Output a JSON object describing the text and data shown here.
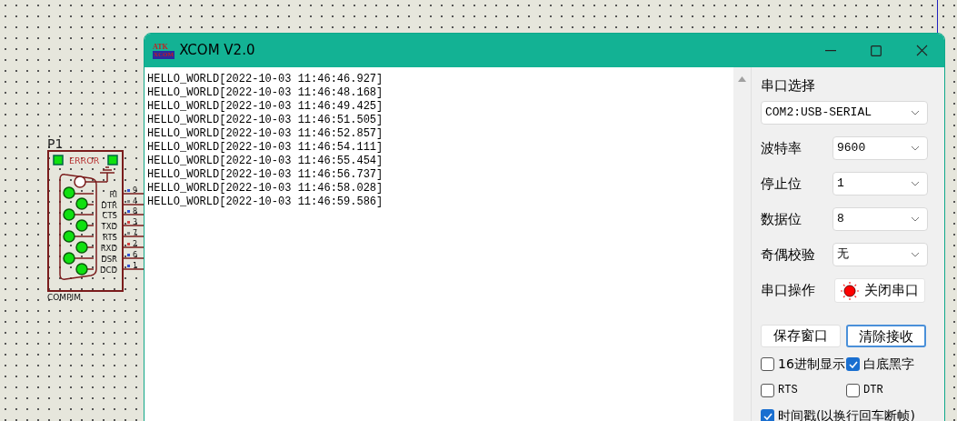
{
  "schematic": {
    "ref": "P1",
    "type": "COMPIM",
    "error_label": "ERROR",
    "pins": [
      {
        "name": "RI",
        "number": "9",
        "color": "#3050d0"
      },
      {
        "name": "DTR",
        "number": "4",
        "color": "#808080"
      },
      {
        "name": "CTS",
        "number": "8",
        "color": "#3050d0"
      },
      {
        "name": "TXD",
        "number": "3",
        "color": "#d04040"
      },
      {
        "name": "RTS",
        "number": "7",
        "color": "#808080"
      },
      {
        "name": "RXD",
        "number": "2",
        "color": "#d04040"
      },
      {
        "name": "DSR",
        "number": "6",
        "color": "#3050d0"
      },
      {
        "name": "DCD",
        "number": "1",
        "color": "#3050d0"
      }
    ]
  },
  "window": {
    "title": "XCOM V2.0",
    "logo_top": "ATK",
    "logo_bottom": "XCOM",
    "receive_lines": [
      "HELLO_WORLD[2022-10-03 11:46:46.927]",
      "HELLO_WORLD[2022-10-03 11:46:48.168]",
      "HELLO_WORLD[2022-10-03 11:46:49.425]",
      "HELLO_WORLD[2022-10-03 11:46:51.505]",
      "HELLO_WORLD[2022-10-03 11:46:52.857]",
      "HELLO_WORLD[2022-10-03 11:46:54.111]",
      "HELLO_WORLD[2022-10-03 11:46:55.454]",
      "HELLO_WORLD[2022-10-03 11:46:56.737]",
      "HELLO_WORLD[2022-10-03 11:46:58.028]",
      "HELLO_WORLD[2022-10-03 11:46:59.586]"
    ],
    "panel": {
      "port_label": "串口选择",
      "port_value": "COM2:USB-SERIAL",
      "settings": [
        {
          "label": "波特率",
          "value": "9600"
        },
        {
          "label": "停止位",
          "value": "1"
        },
        {
          "label": "数据位",
          "value": "8"
        },
        {
          "label": "奇偶校验",
          "value": "无"
        }
      ],
      "operation_label": "串口操作",
      "port_open": true,
      "toggle_button": "关闭串口",
      "buttons": [
        {
          "label": "保存窗口",
          "selected": false
        },
        {
          "label": "清除接收",
          "selected": true
        }
      ],
      "checkboxes": [
        {
          "label": "16进制显示",
          "checked": false
        },
        {
          "label": "白底黑字",
          "checked": true
        },
        {
          "label": "RTS",
          "checked": false
        },
        {
          "label": "DTR",
          "checked": false
        },
        {
          "label": "时间戳(以换行回车断帧)",
          "checked": true
        }
      ]
    }
  }
}
